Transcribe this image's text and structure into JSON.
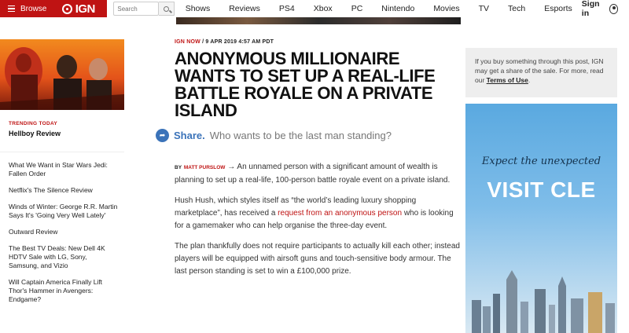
{
  "header": {
    "browse_label": "Browse",
    "logo_text": "IGN",
    "search_placeholder": "Search",
    "nav": [
      "Shows",
      "Reviews",
      "PS4",
      "Xbox",
      "PC",
      "Nintendo",
      "Movies",
      "TV",
      "Tech",
      "Esports"
    ],
    "signin_label": "Sign in"
  },
  "sidebar": {
    "trending_label": "TRENDING TODAY",
    "trending_title": "Hellboy Review",
    "items": [
      "What We Want in Star Wars Jedi: Fallen Order",
      "Netflix's The Silence Review",
      "Winds of Winter: George R.R. Martin Says It's 'Going Very Well Lately'",
      "Outward Review",
      "The Best TV Deals: New Dell 4K HDTV Sale with LG, Sony, Samsung, and Vizio",
      "Will Captain America Finally Lift Thor's Hammer in Avengers: Endgame?"
    ]
  },
  "article": {
    "source": "IGN NOW",
    "date": "9 APR 2019 4:57 AM PDT",
    "headline": "ANONYMOUS MILLIONAIRE WANTS TO SET UP A REAL-LIFE BATTLE ROYALE ON A PRIVATE ISLAND",
    "share_label": "Share.",
    "subhead": "Who wants to be the last man standing?",
    "by_label": "BY",
    "author": "MATT PURSLOW",
    "lead": "An unnamed person with a significant amount of wealth is planning to set up a real-life, 100-person battle royale event on a private island.",
    "p2_before": "Hush Hush, which styles itself as “the world’s leading luxury shopping marketplace”, has received a ",
    "p2_link": "request from an anonymous person",
    "p2_after": " who is looking for a gamemaker who can help organise the three-day event.",
    "p3": "The plan thankfully does not require participants to actually kill each other; instead players will be equipped with airsoft guns and touch-sensitive body armour. The last person standing is set to win a £100,000 prize."
  },
  "rail": {
    "disclosure_text": "If you buy something through this post, IGN may get a share of the sale. For more, read our ",
    "disclosure_link": "Terms of Use",
    "disclosure_end": ".",
    "ad_tagline": "Expect the unexpected",
    "ad_title": "VISIT CLE"
  },
  "colors": {
    "brand_red": "#bf1313",
    "share_blue": "#3b73b9"
  }
}
